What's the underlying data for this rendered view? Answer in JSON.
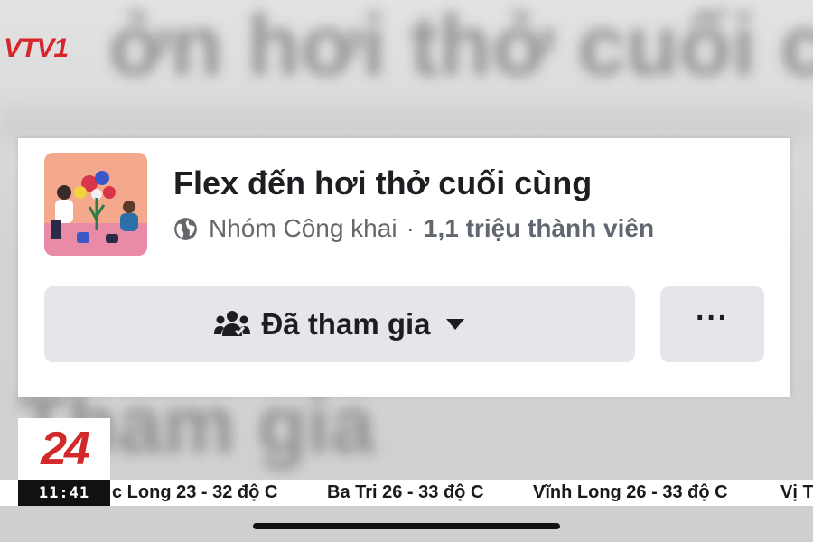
{
  "channel_logo": "VTV1",
  "background_blur_text": {
    "top": "ởn hơi thở cuối c",
    "bottom": "Tham gia"
  },
  "group_card": {
    "avatar_icon": "group-illustration-icon",
    "name": "Flex đến hơi thở cuối cùng",
    "privacy_icon": "globe-icon",
    "privacy": "Nhóm Công khai",
    "separator": "·",
    "members": "1,1 triệu thành viên",
    "join_button": {
      "icon": "people-icon",
      "label": "Đã tham gia",
      "dropdown_icon": "caret-down-icon"
    },
    "more_button": {
      "label": "···"
    }
  },
  "news_overlay": {
    "badge": "24",
    "clock": "11:41",
    "ticker": [
      "c Long 23 - 32 độ C",
      "Ba Tri 26 - 33 độ C",
      "Vĩnh Long 26 - 33 độ C",
      "Vị T"
    ]
  },
  "colors": {
    "button_bg": "#e4e6eb",
    "vtv_red": "#d6262c",
    "badge_red": "#d22a2a",
    "text_secondary": "#65676b"
  }
}
